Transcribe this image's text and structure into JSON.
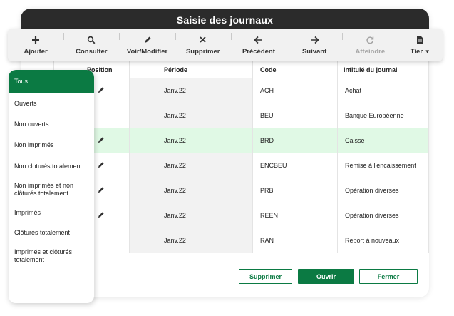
{
  "window": {
    "title": "Saisie des journaux"
  },
  "toolbar": {
    "items": [
      {
        "label": "Ajouter",
        "icon": "plus-icon",
        "enabled": true
      },
      {
        "label": "Consulter",
        "icon": "search-icon",
        "enabled": true
      },
      {
        "label": "Voir/Modifier",
        "icon": "pencil-icon",
        "enabled": true
      },
      {
        "label": "Supprimer",
        "icon": "close-icon",
        "enabled": true
      },
      {
        "label": "Précédent",
        "icon": "arrow-left-icon",
        "enabled": true
      },
      {
        "label": "Suivant",
        "icon": "arrow-right-icon",
        "enabled": true
      },
      {
        "label": "Atteindre",
        "icon": "refresh-icon",
        "enabled": false
      },
      {
        "label": "Tier",
        "icon": "document-icon",
        "enabled": true,
        "has_dropdown": true
      }
    ]
  },
  "table": {
    "headers": {
      "position": "Position",
      "periode": "Période",
      "code": "Code",
      "intitule": "Intitulé du journal"
    },
    "rows": [
      {
        "edit": true,
        "periode": "Janv.22",
        "code": "ACH",
        "intitule": "Achat"
      },
      {
        "edit": false,
        "periode": "Janv.22",
        "code": "BEU",
        "intitule": "Banque Européenne"
      },
      {
        "edit": true,
        "periode": "Janv.22",
        "code": "BRD",
        "intitule": "Caisse",
        "selected": true
      },
      {
        "edit": true,
        "periode": "Janv.22",
        "code": "ENCBEU",
        "intitule": "Remise à l'encaissement"
      },
      {
        "edit": true,
        "periode": "Janv.22",
        "code": "PRB",
        "intitule": "Opération diverses"
      },
      {
        "edit": true,
        "periode": "Janv.22",
        "code": "REEN",
        "intitule": "Opération diverses"
      },
      {
        "edit": false,
        "periode": "Janv.22",
        "code": "RAN",
        "intitule": "Report à nouveaux"
      }
    ]
  },
  "filter": {
    "items": [
      {
        "label": "Tous",
        "active": true
      },
      {
        "label": "Ouverts"
      },
      {
        "label": "Non ouverts"
      },
      {
        "label": "Non imprimés"
      },
      {
        "label": "Non cloturés totalement"
      },
      {
        "label": "Non imprimés et non clôturés totalement"
      },
      {
        "label": "Imprimés"
      },
      {
        "label": "Clôturés totalement"
      },
      {
        "label": "Imprimés et clôturés totalement"
      }
    ]
  },
  "actions": {
    "supprimer": "Supprimer",
    "ouvrir": "Ouvrir",
    "fermer": "Fermer"
  },
  "colors": {
    "accent": "#0b7a43",
    "selected_row": "#e0f9e5",
    "title_bar": "#2b2b2b"
  }
}
